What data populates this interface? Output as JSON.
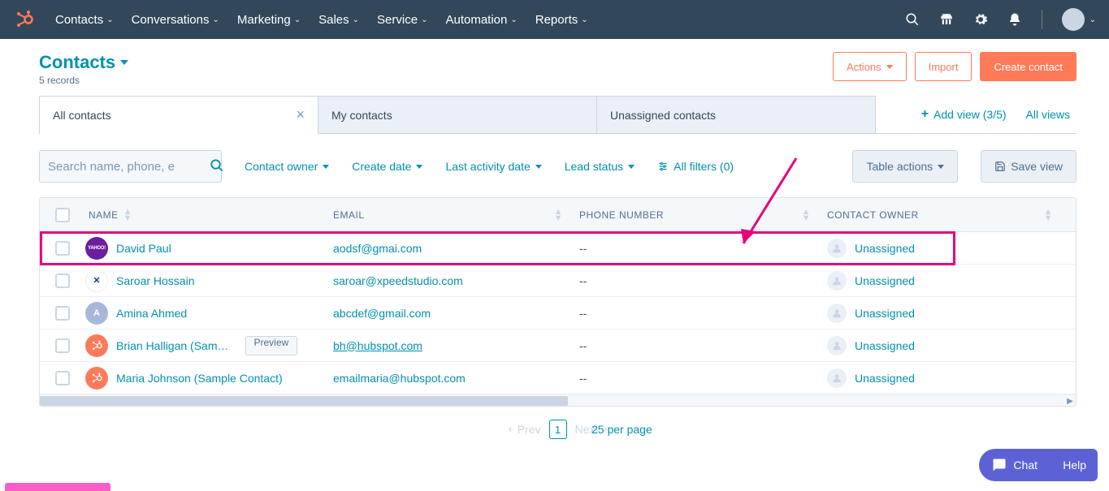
{
  "nav": {
    "items": [
      "Contacts",
      "Conversations",
      "Marketing",
      "Sales",
      "Service",
      "Automation",
      "Reports"
    ]
  },
  "page": {
    "title": "Contacts",
    "records": "5 records"
  },
  "header_buttons": {
    "actions": "Actions",
    "import": "Import",
    "create": "Create contact"
  },
  "tabs": {
    "items": [
      {
        "label": "All contacts",
        "active": true,
        "closable": true
      },
      {
        "label": "My contacts",
        "active": false,
        "closable": false
      },
      {
        "label": "Unassigned contacts",
        "active": false,
        "closable": false
      }
    ],
    "add_view": "Add view (3/5)",
    "all_views": "All views"
  },
  "filters": {
    "search_placeholder": "Search name, phone, e",
    "contact_owner": "Contact owner",
    "create_date": "Create date",
    "last_activity": "Last activity date",
    "lead_status": "Lead status",
    "all_filters": "All filters (0)",
    "table_actions": "Table actions",
    "save_view": "Save view"
  },
  "table": {
    "columns": {
      "name": "NAME",
      "email": "EMAIL",
      "phone": "PHONE NUMBER",
      "owner": "CONTACT OWNER"
    },
    "rows": [
      {
        "name": "David Paul",
        "email": "aodsf@gmai.com",
        "phone": "--",
        "owner": "Unassigned",
        "avatar_bg": "#6b1e9e",
        "avatar_text": "YAHOO!",
        "underline": false,
        "preview": false,
        "highlight": true
      },
      {
        "name": "Saroar Hossain",
        "email": "saroar@xpeedstudio.com",
        "phone": "--",
        "owner": "Unassigned",
        "avatar_bg": "#ffffff",
        "avatar_text": "✕",
        "underline": false,
        "preview": false,
        "highlight": false
      },
      {
        "name": "Amina Ahmed",
        "email": "abcdef@gmail.com",
        "phone": "--",
        "owner": "Unassigned",
        "avatar_bg": "#a7b8d9",
        "avatar_text": "A",
        "underline": false,
        "preview": false,
        "highlight": false
      },
      {
        "name": "Brian Halligan (Sam…",
        "email": "bh@hubspot.com",
        "phone": "--",
        "owner": "Unassigned",
        "avatar_bg": "#ff7a59",
        "avatar_text": "",
        "underline": true,
        "preview": true,
        "highlight": false
      },
      {
        "name": "Maria Johnson (Sample Contact)",
        "email": "emailmaria@hubspot.com",
        "phone": "--",
        "owner": "Unassigned",
        "avatar_bg": "#ff7a59",
        "avatar_text": "",
        "underline": false,
        "preview": false,
        "highlight": false
      }
    ],
    "preview_label": "Preview"
  },
  "pager": {
    "prev": "Prev",
    "page": "1",
    "next": "Next",
    "per_page": "25 per page"
  },
  "widgets": {
    "chat": "Chat",
    "help": "Help"
  }
}
